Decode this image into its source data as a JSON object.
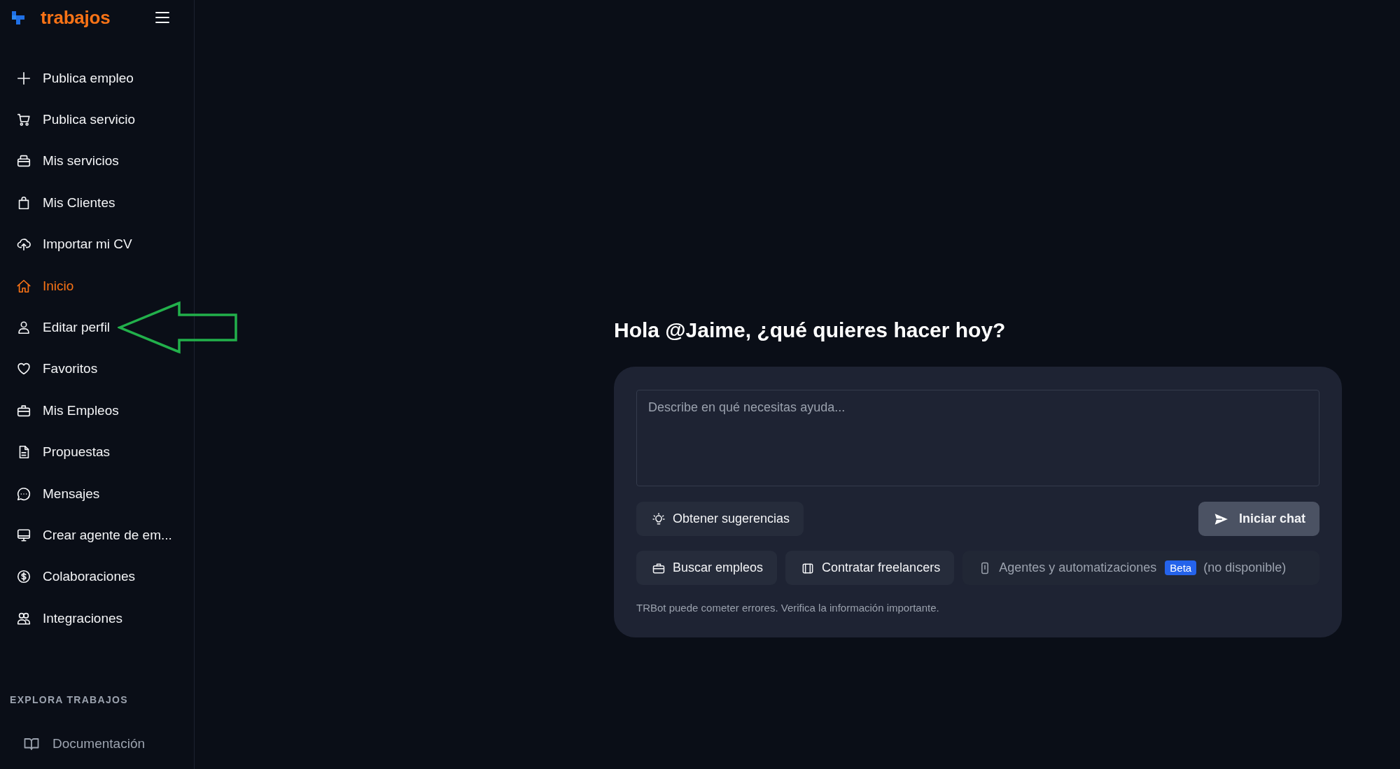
{
  "brand": {
    "name": "trabajos"
  },
  "sidebar": {
    "items": [
      {
        "label": "Publica empleo",
        "selected": false,
        "annotated": false
      },
      {
        "label": "Publica servicio",
        "selected": false,
        "annotated": false
      },
      {
        "label": "Mis servicios",
        "selected": false,
        "annotated": false
      },
      {
        "label": "Mis Clientes",
        "selected": false,
        "annotated": false
      },
      {
        "label": "Importar mi CV",
        "selected": false,
        "annotated": false
      },
      {
        "label": "Inicio",
        "selected": true,
        "annotated": false
      },
      {
        "label": "Editar perfil",
        "selected": false,
        "annotated": true
      },
      {
        "label": "Favoritos",
        "selected": false,
        "annotated": false
      },
      {
        "label": "Mis Empleos",
        "selected": false,
        "annotated": false
      },
      {
        "label": "Propuestas",
        "selected": false,
        "annotated": false
      },
      {
        "label": "Mensajes",
        "selected": false,
        "annotated": false
      },
      {
        "label": "Crear agente de em...",
        "selected": false,
        "annotated": false
      },
      {
        "label": "Colaboraciones",
        "selected": false,
        "annotated": false
      },
      {
        "label": "Integraciones",
        "selected": false,
        "annotated": false
      }
    ],
    "section_title": "EXPLORA TRABAJOS",
    "section_items": [
      {
        "label": "Documentación"
      }
    ]
  },
  "main": {
    "greeting": "Hola @Jaime, ¿qué quieres hacer hoy?",
    "prompt": {
      "placeholder": "Describe en qué necesitas ayuda..."
    },
    "suggest_button": "Obtener sugerencias",
    "start_button": "Iniciar chat",
    "shortcuts": [
      {
        "label": "Buscar empleos",
        "disabled": false
      },
      {
        "label": "Contratar freelancers",
        "disabled": false
      },
      {
        "label": "Agentes y automatizaciones",
        "badge": "Beta",
        "note": "(no disponible)",
        "disabled": true
      }
    ],
    "disclaimer": "TRBot puede cometer errores. Verifica la información importante."
  }
}
